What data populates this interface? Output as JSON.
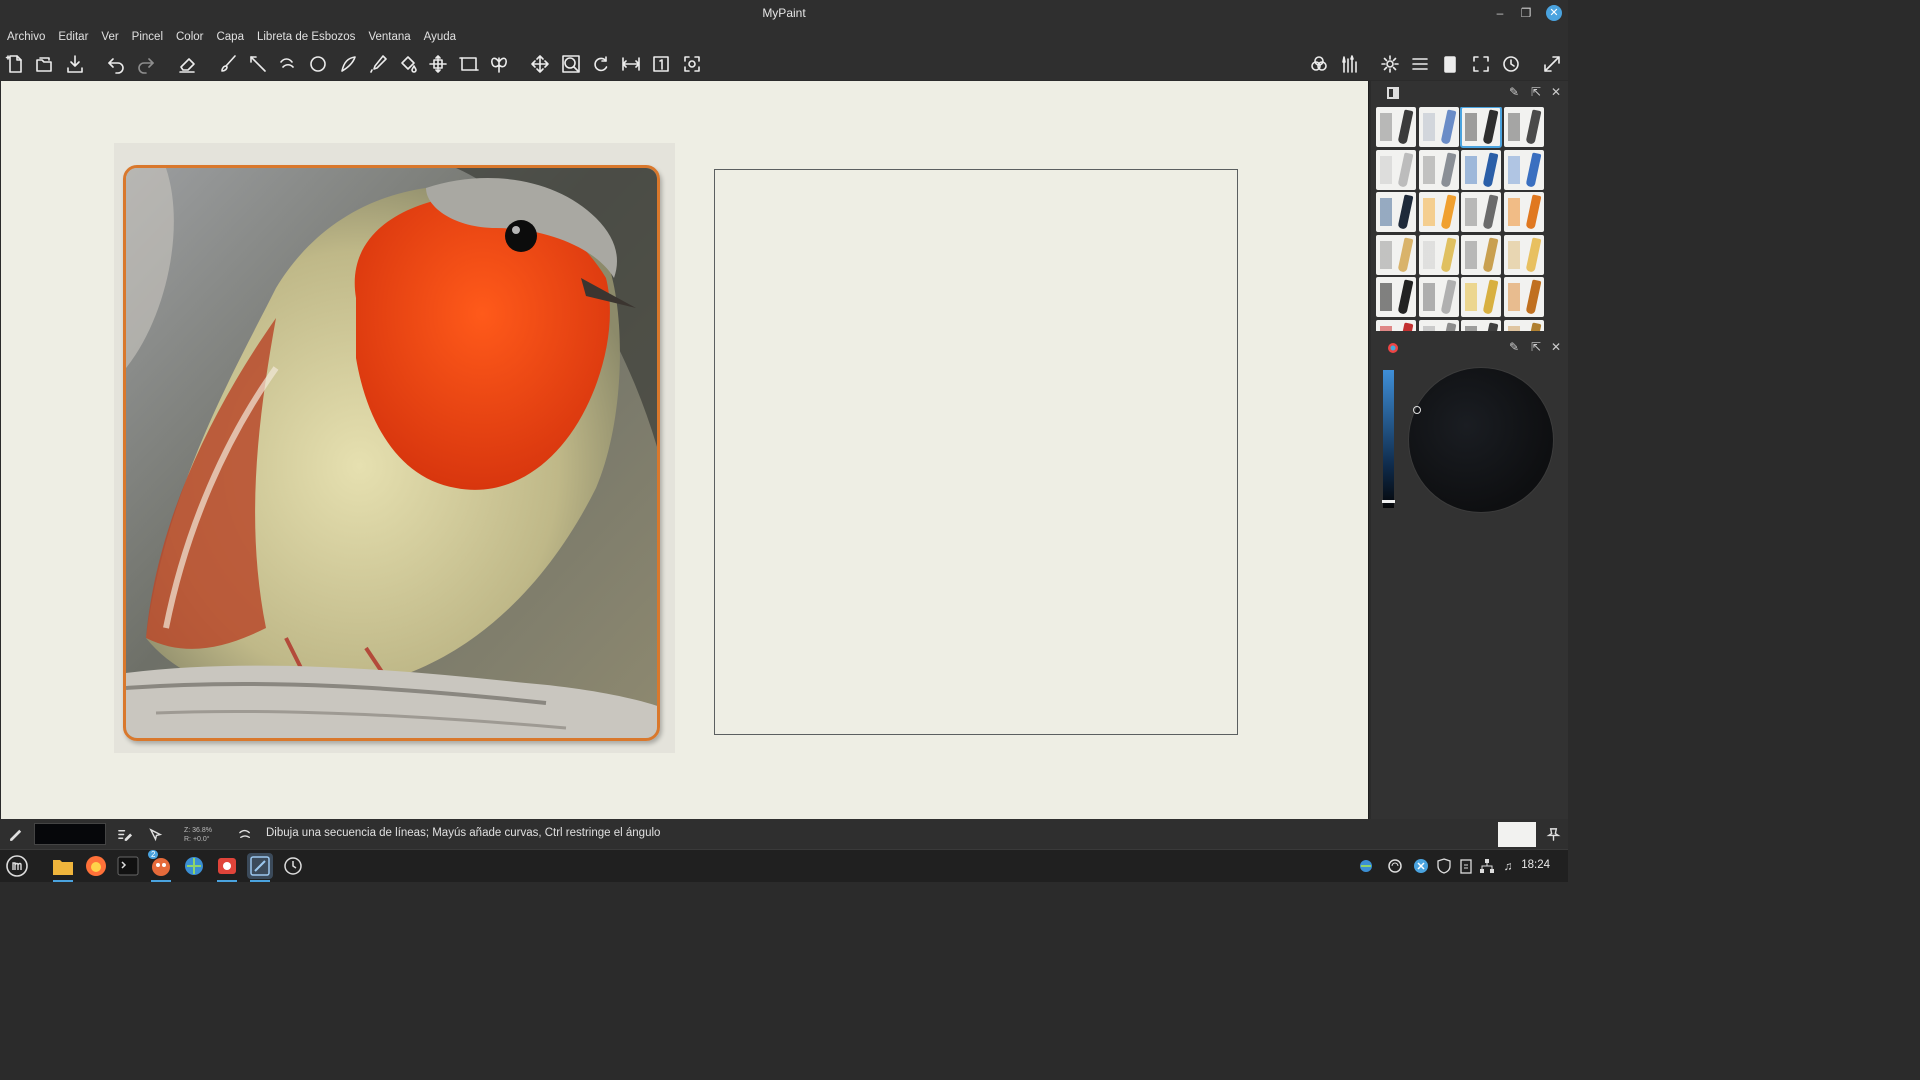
{
  "window": {
    "title": "MyPaint"
  },
  "menu": [
    "Archivo",
    "Editar",
    "Ver",
    "Pincel",
    "Color",
    "Capa",
    "Libreta de Esbozos",
    "Ventana",
    "Ayuda"
  ],
  "status": {
    "zoom": "Z: 36.8%",
    "rotation": "R: +0.0°",
    "message": "Dibuja una secuencia de líneas; Mayús añade curvas, Ctrl restringe el ángulo",
    "current_color": "#06070a"
  },
  "taskbar": {
    "clock": "18:24",
    "badge": "2"
  },
  "colors": {
    "accent": "#4aa3df",
    "canvas": "#eeeee4",
    "chrome": "#2f2f2f"
  }
}
